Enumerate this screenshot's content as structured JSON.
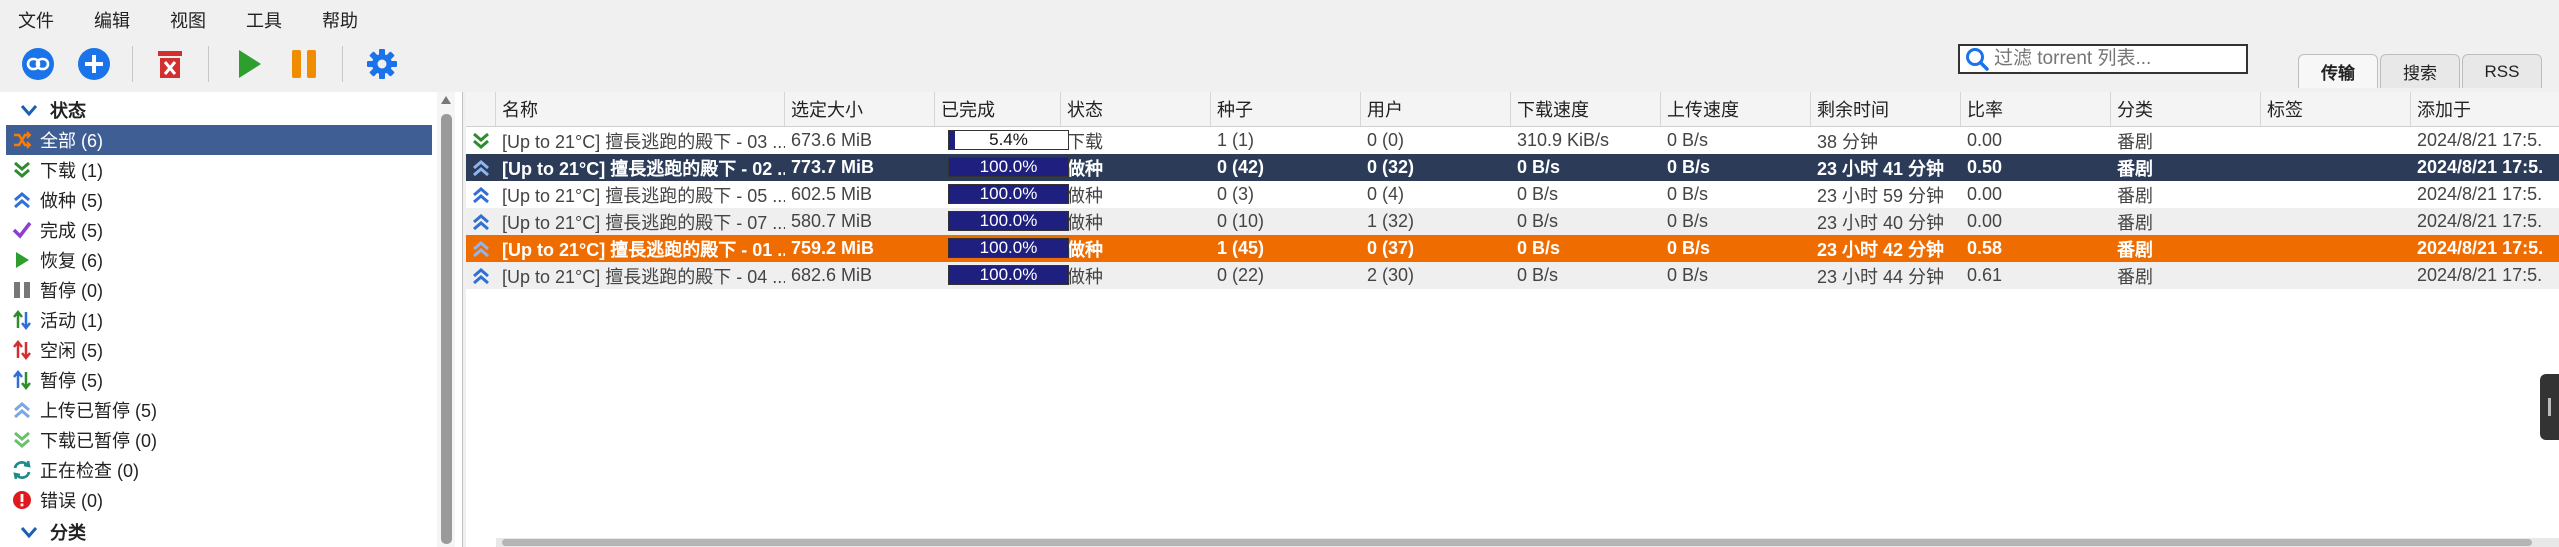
{
  "menu": [
    "文件",
    "编辑",
    "视图",
    "工具",
    "帮助"
  ],
  "toolbar": {
    "buttons": [
      {
        "name": "add-link-button",
        "icon": "link-icon",
        "color": "#1a73e8"
      },
      {
        "name": "add-torrent-button",
        "icon": "plus-icon",
        "color": "#1a73e8"
      },
      {
        "name": "delete-button",
        "icon": "delete-icon",
        "color": "#d32f2f"
      },
      {
        "name": "resume-button",
        "icon": "play-icon",
        "color": "#2e9e2e"
      },
      {
        "name": "pause-button",
        "icon": "pause-icon",
        "color": "#f08c00"
      },
      {
        "name": "options-button",
        "icon": "gear-icon",
        "color": "#1a73e8"
      }
    ]
  },
  "search": {
    "placeholder": "过滤 torrent 列表..."
  },
  "tabs": [
    "传输",
    "搜索",
    "RSS"
  ],
  "active_tab": "传输",
  "sidebar": {
    "status_header": "状态",
    "category_header": "分类",
    "items": [
      {
        "label": "全部 (6)",
        "icon": "shuffle-icon",
        "selected": true
      },
      {
        "label": "下载 (1)",
        "icon": "download-icon"
      },
      {
        "label": "做种 (5)",
        "icon": "upload-icon"
      },
      {
        "label": "完成 (5)",
        "icon": "check-icon"
      },
      {
        "label": "恢复 (6)",
        "icon": "play-icon"
      },
      {
        "label": "暂停 (0)",
        "icon": "pause-icon"
      },
      {
        "label": "活动 (1)",
        "icon": "updown-active-icon"
      },
      {
        "label": "空闲 (5)",
        "icon": "updown-inactive-icon"
      },
      {
        "label": "暂停 (5)",
        "icon": "updown-stalled-icon"
      },
      {
        "label": "上传已暂停 (5)",
        "icon": "upload-paused-icon"
      },
      {
        "label": "下载已暂停 (0)",
        "icon": "download-paused-icon"
      },
      {
        "label": "正在检查 (0)",
        "icon": "refresh-icon"
      },
      {
        "label": "错误 (0)",
        "icon": "error-icon"
      }
    ]
  },
  "table": {
    "columns": [
      "名称",
      "选定大小",
      "已完成",
      "状态",
      "种子",
      "用户",
      "下载速度",
      "上传速度",
      "剩余时间",
      "比率",
      "分类",
      "标签",
      "添加于"
    ],
    "rows": [
      {
        "icon": "download",
        "name": "[Up to 21°C] 擅長逃跑的殿下 - 03 ...",
        "size": "673.6 MiB",
        "progress": 5.4,
        "progress_text": "5.4%",
        "status": "下载",
        "seeds": "1 (1)",
        "peers": "0 (0)",
        "dl": "310.9 KiB/s",
        "ul": "0 B/s",
        "eta": "38 分钟",
        "ratio": "0.00",
        "category": "番剧",
        "tags": "",
        "added": "2024/8/21 17:5.",
        "style": "plain"
      },
      {
        "icon": "upload",
        "name": "[Up to 21°C] 擅長逃跑的殿下 - 02 ...",
        "size": "773.7 MiB",
        "progress": 100,
        "progress_text": "100.0%",
        "status": "做种",
        "seeds": "0 (42)",
        "peers": "0 (32)",
        "dl": "0 B/s",
        "ul": "0 B/s",
        "eta": "23 小时 41 分钟",
        "ratio": "0.50",
        "category": "番剧",
        "tags": "",
        "added": "2024/8/21 17:5.",
        "style": "sel-dark"
      },
      {
        "icon": "upload",
        "name": "[Up to 21°C] 擅長逃跑的殿下 - 05 ...",
        "size": "602.5 MiB",
        "progress": 100,
        "progress_text": "100.0%",
        "status": "做种",
        "seeds": "0 (3)",
        "peers": "0 (4)",
        "dl": "0 B/s",
        "ul": "0 B/s",
        "eta": "23 小时 59 分钟",
        "ratio": "0.00",
        "category": "番剧",
        "tags": "",
        "added": "2024/8/21 17:5.",
        "style": "plain"
      },
      {
        "icon": "upload",
        "name": "[Up to 21°C] 擅長逃跑的殿下 - 07 ...",
        "size": "580.7 MiB",
        "progress": 100,
        "progress_text": "100.0%",
        "status": "做种",
        "seeds": "0 (10)",
        "peers": "1 (32)",
        "dl": "0 B/s",
        "ul": "0 B/s",
        "eta": "23 小时 40 分钟",
        "ratio": "0.00",
        "category": "番剧",
        "tags": "",
        "added": "2024/8/21 17:5.",
        "style": "alt"
      },
      {
        "icon": "upload",
        "name": "[Up to 21°C] 擅長逃跑的殿下 - 01 ...",
        "size": "759.2 MiB",
        "progress": 100,
        "progress_text": "100.0%",
        "status": "做种",
        "seeds": "1 (45)",
        "peers": "0 (37)",
        "dl": "0 B/s",
        "ul": "0 B/s",
        "eta": "23 小时 42 分钟",
        "ratio": "0.58",
        "category": "番剧",
        "tags": "",
        "added": "2024/8/21 17:5.",
        "style": "sel-orange"
      },
      {
        "icon": "upload",
        "name": "[Up to 21°C] 擅長逃跑的殿下 - 04 ...",
        "size": "682.6 MiB",
        "progress": 100,
        "progress_text": "100.0%",
        "status": "做种",
        "seeds": "0 (22)",
        "peers": "2 (30)",
        "dl": "0 B/s",
        "ul": "0 B/s",
        "eta": "23 小时 44 分钟",
        "ratio": "0.61",
        "category": "番剧",
        "tags": "",
        "added": "2024/8/21 17:5.",
        "style": "alt"
      }
    ]
  }
}
